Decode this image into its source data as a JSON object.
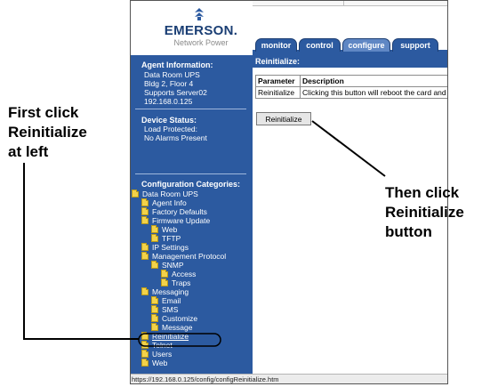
{
  "branding": {
    "company": "EMERSON.",
    "division": "Network Power"
  },
  "tabs": [
    {
      "label": "monitor",
      "active": false
    },
    {
      "label": "control",
      "active": false
    },
    {
      "label": "configure",
      "active": true
    },
    {
      "label": "support",
      "active": false
    }
  ],
  "agent_info": {
    "heading": "Agent Information:",
    "lines": [
      "Data Room UPS",
      "Bldg 2, Floor 4",
      "Supports Server02",
      "192.168.0.125"
    ]
  },
  "device_status": {
    "heading": "Device Status:",
    "lines": [
      "Load Protected:",
      "No Alarms Present"
    ]
  },
  "config_categories": {
    "heading": "Configuration Categories:",
    "items": [
      {
        "label": "Data Room UPS",
        "level": 0,
        "link": false
      },
      {
        "label": "Agent Info",
        "level": 1,
        "link": false
      },
      {
        "label": "Factory Defaults",
        "level": 1,
        "link": false
      },
      {
        "label": "Firmware Update",
        "level": 1,
        "link": false
      },
      {
        "label": "Web",
        "level": 2,
        "link": false
      },
      {
        "label": "TFTP",
        "level": 2,
        "link": false
      },
      {
        "label": "IP Settings",
        "level": 1,
        "link": false
      },
      {
        "label": "Management Protocol",
        "level": 1,
        "link": false
      },
      {
        "label": "SNMP",
        "level": 2,
        "link": false
      },
      {
        "label": "Access",
        "level": 3,
        "link": false
      },
      {
        "label": "Traps",
        "level": 3,
        "link": false
      },
      {
        "label": "Messaging",
        "level": 1,
        "link": false
      },
      {
        "label": "Email",
        "level": 2,
        "link": false
      },
      {
        "label": "SMS",
        "level": 2,
        "link": false
      },
      {
        "label": "Customize",
        "level": 2,
        "link": false
      },
      {
        "label": "Message",
        "level": 2,
        "link": false
      },
      {
        "label": "Reinitialize",
        "level": 1,
        "link": true
      },
      {
        "label": "Telnet",
        "level": 1,
        "link": false
      },
      {
        "label": "Users",
        "level": 1,
        "link": false
      },
      {
        "label": "Web",
        "level": 1,
        "link": false
      }
    ]
  },
  "content": {
    "title": "Reinitialize:",
    "table": {
      "headers": [
        "Parameter",
        "Description"
      ],
      "rows": [
        [
          "Reinitialize",
          "Clicking this button will reboot the card and"
        ]
      ]
    },
    "button_label": "Reinitialize"
  },
  "status_bar": {
    "url": "https://192.168.0.125/config/configReinitialize.htm"
  },
  "callouts": {
    "left": [
      "First click",
      "Reinitialize",
      "at left"
    ],
    "right": [
      "Then click",
      "Reinitialize",
      "button"
    ]
  },
  "colors": {
    "panel_blue": "#2c5aa0",
    "active_tab": "#5f87c4",
    "folder_yellow": "#f2d24a"
  }
}
